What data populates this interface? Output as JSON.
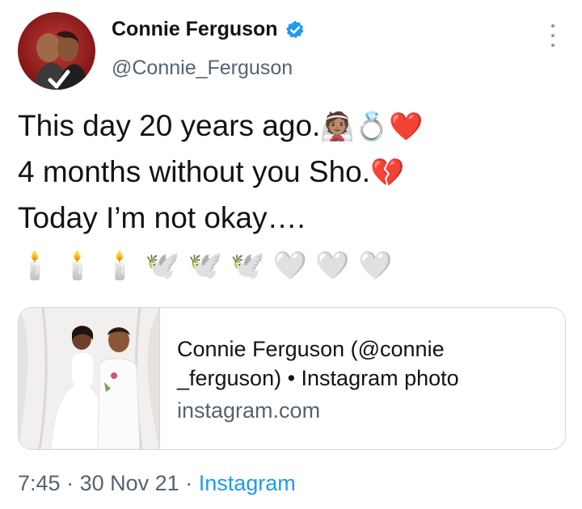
{
  "tweet": {
    "author": {
      "display_name": "Connie Ferguson",
      "handle": "@Connie_Ferguson",
      "verified_icon": "verified-badge-icon",
      "avatar_icon": "profile-avatar"
    },
    "more_icon": "more-options-icon",
    "text_lines": [
      "This day 20 years ago.",
      "4 months without you Sho.",
      "Today I’m not okay…."
    ],
    "emojis": {
      "line1": [
        "👰🏽",
        "💍",
        "❤️"
      ],
      "line2": [
        "💔"
      ],
      "line4": [
        "🕯️",
        "🕯️",
        "🕯️",
        "🕊️",
        "🕊️",
        "🕊️",
        "🤍",
        "🤍",
        "🤍"
      ]
    },
    "card": {
      "title_line1": "Connie Ferguson (@connie",
      "title_line2": "_ferguson) • Instagram photo",
      "domain": "instagram.com"
    },
    "meta": {
      "time": "7:45",
      "separator": "·",
      "date": "30 Nov 21",
      "source": "Instagram"
    },
    "colors": {
      "text": "#0f1419",
      "secondary": "#536471",
      "link": "#1d9bf0",
      "border": "#cfd9de",
      "heart_red": "#e0245e",
      "broken_heart": "#f25a9a"
    }
  }
}
